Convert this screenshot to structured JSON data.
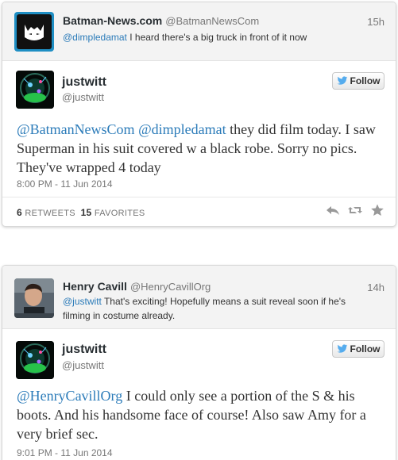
{
  "tweet1": {
    "reply": {
      "name": "Batman-News.com",
      "handle": "@BatmanNewsCom",
      "time": "15h",
      "mention": "@dimpledamat",
      "text": " I heard there's a big truck in front of it now"
    },
    "main": {
      "name": "justwitt",
      "handle": "@justwitt",
      "follow_label": "Follow",
      "mention1": "@BatmanNewsCom",
      "mention2": "@dimpledamat",
      "text": " they did film today. I saw Superman in his suit covered w a black robe. Sorry no pics. They've wrapped 4 today",
      "timestamp": "8:00 PM - 11 Jun 2014",
      "retweets_count": "6",
      "retweets_label": "RETWEETS",
      "favorites_count": "15",
      "favorites_label": "FAVORITES"
    }
  },
  "tweet2": {
    "reply": {
      "name": "Henry Cavill",
      "handle": "@HenryCavillOrg",
      "time": "14h",
      "mention": "@justwitt",
      "text": " That's exciting!  Hopefully means a suit reveal soon if he's filming in costume already."
    },
    "main": {
      "name": "justwitt",
      "handle": "@justwitt",
      "follow_label": "Follow",
      "mention1": "@HenryCavillOrg",
      "text": " I could only see a portion of the S & his boots. And his handsome face of course! Also saw Amy for a very brief sec.",
      "timestamp": "9:01 PM - 11 Jun 2014"
    }
  },
  "colors": {
    "link": "#2b7bb9",
    "twitter_bird": "#55acee",
    "reply_bg": "#f3f3f3"
  }
}
